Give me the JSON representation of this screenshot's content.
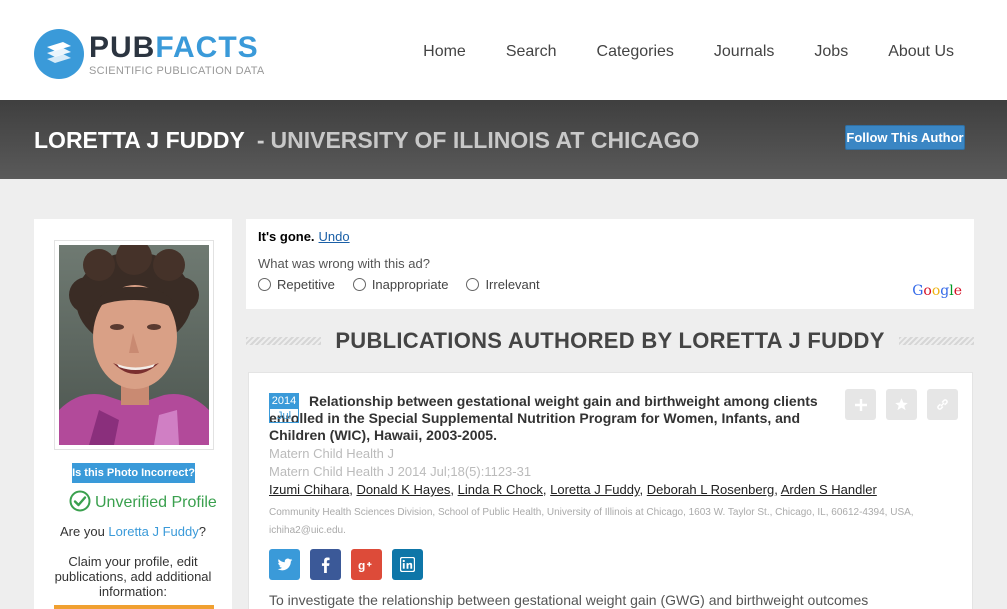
{
  "header": {
    "logo_pub": "PUB",
    "logo_facts": "FACTS",
    "logo_tagline": "SCIENTIFIC PUBLICATION DATA",
    "nav": [
      "Home",
      "Search",
      "Categories",
      "Journals",
      "Jobs",
      "About Us"
    ]
  },
  "title_band": {
    "name": "LORETTA J FUDDY",
    "separator": "-",
    "institution": "UNIVERSITY OF ILLINOIS AT CHICAGO",
    "follow_label": "Follow This Author"
  },
  "sidebar": {
    "photo_incorrect_label": "Is this Photo Incorrect?",
    "unverified_label": "Unverified Profile",
    "are_you_prefix": "Are you ",
    "are_you_name": "Loretta J Fuddy",
    "are_you_suffix": "?",
    "claim_text": "Claim your profile, edit publications, add additional information:"
  },
  "ad": {
    "gone_text": "It's gone.",
    "undo_label": "Undo",
    "question": "What was wrong with this ad?",
    "options": [
      "Repetitive",
      "Inappropriate",
      "Irrelevant"
    ],
    "google_label": "Google"
  },
  "publications": {
    "heading": "PUBLICATIONS AUTHORED BY LORETTA J FUDDY",
    "items": [
      {
        "year": "2014",
        "month": "Jul",
        "title": "Relationship between gestational weight gain and birthweight among clients enrolled in the Special Supplemental Nutrition Program for Women, Infants, and Children (WIC), Hawaii, 2003-2005.",
        "journal": "Matern Child Health J",
        "citation": "Matern Child Health J 2014 Jul;18(5):1123-31",
        "authors": [
          "Izumi Chihara",
          "Donald K Hayes",
          "Linda R Chock",
          "Loretta J Fuddy",
          "Deborah L Rosenberg",
          "Arden S Handler"
        ],
        "affiliation": "Community Health Sciences Division, School of Public Health, University of Illinois at Chicago, 1603 W. Taylor St., Chicago, IL, 60612-4394, USA, ichiha2@uic.edu.",
        "abstract_start": "To investigate the relationship between gestational weight gain (GWG) and birthweight outcomes"
      }
    ]
  },
  "colors": {
    "accent": "#3a9ad9",
    "band": "#4a4a4a",
    "verified_green": "#3aa04e",
    "twitter": "#3a9ad9",
    "facebook": "#3b5998",
    "google_plus": "#dd4b39",
    "linkedin": "#0e76a8"
  },
  "icons": {
    "logo": "stacked-papers-icon",
    "unverified": "check-circle-icon",
    "actions": [
      "plus-icon",
      "star-icon",
      "link-icon"
    ],
    "share": [
      "twitter-icon",
      "facebook-icon",
      "google-plus-icon",
      "linkedin-icon"
    ]
  }
}
